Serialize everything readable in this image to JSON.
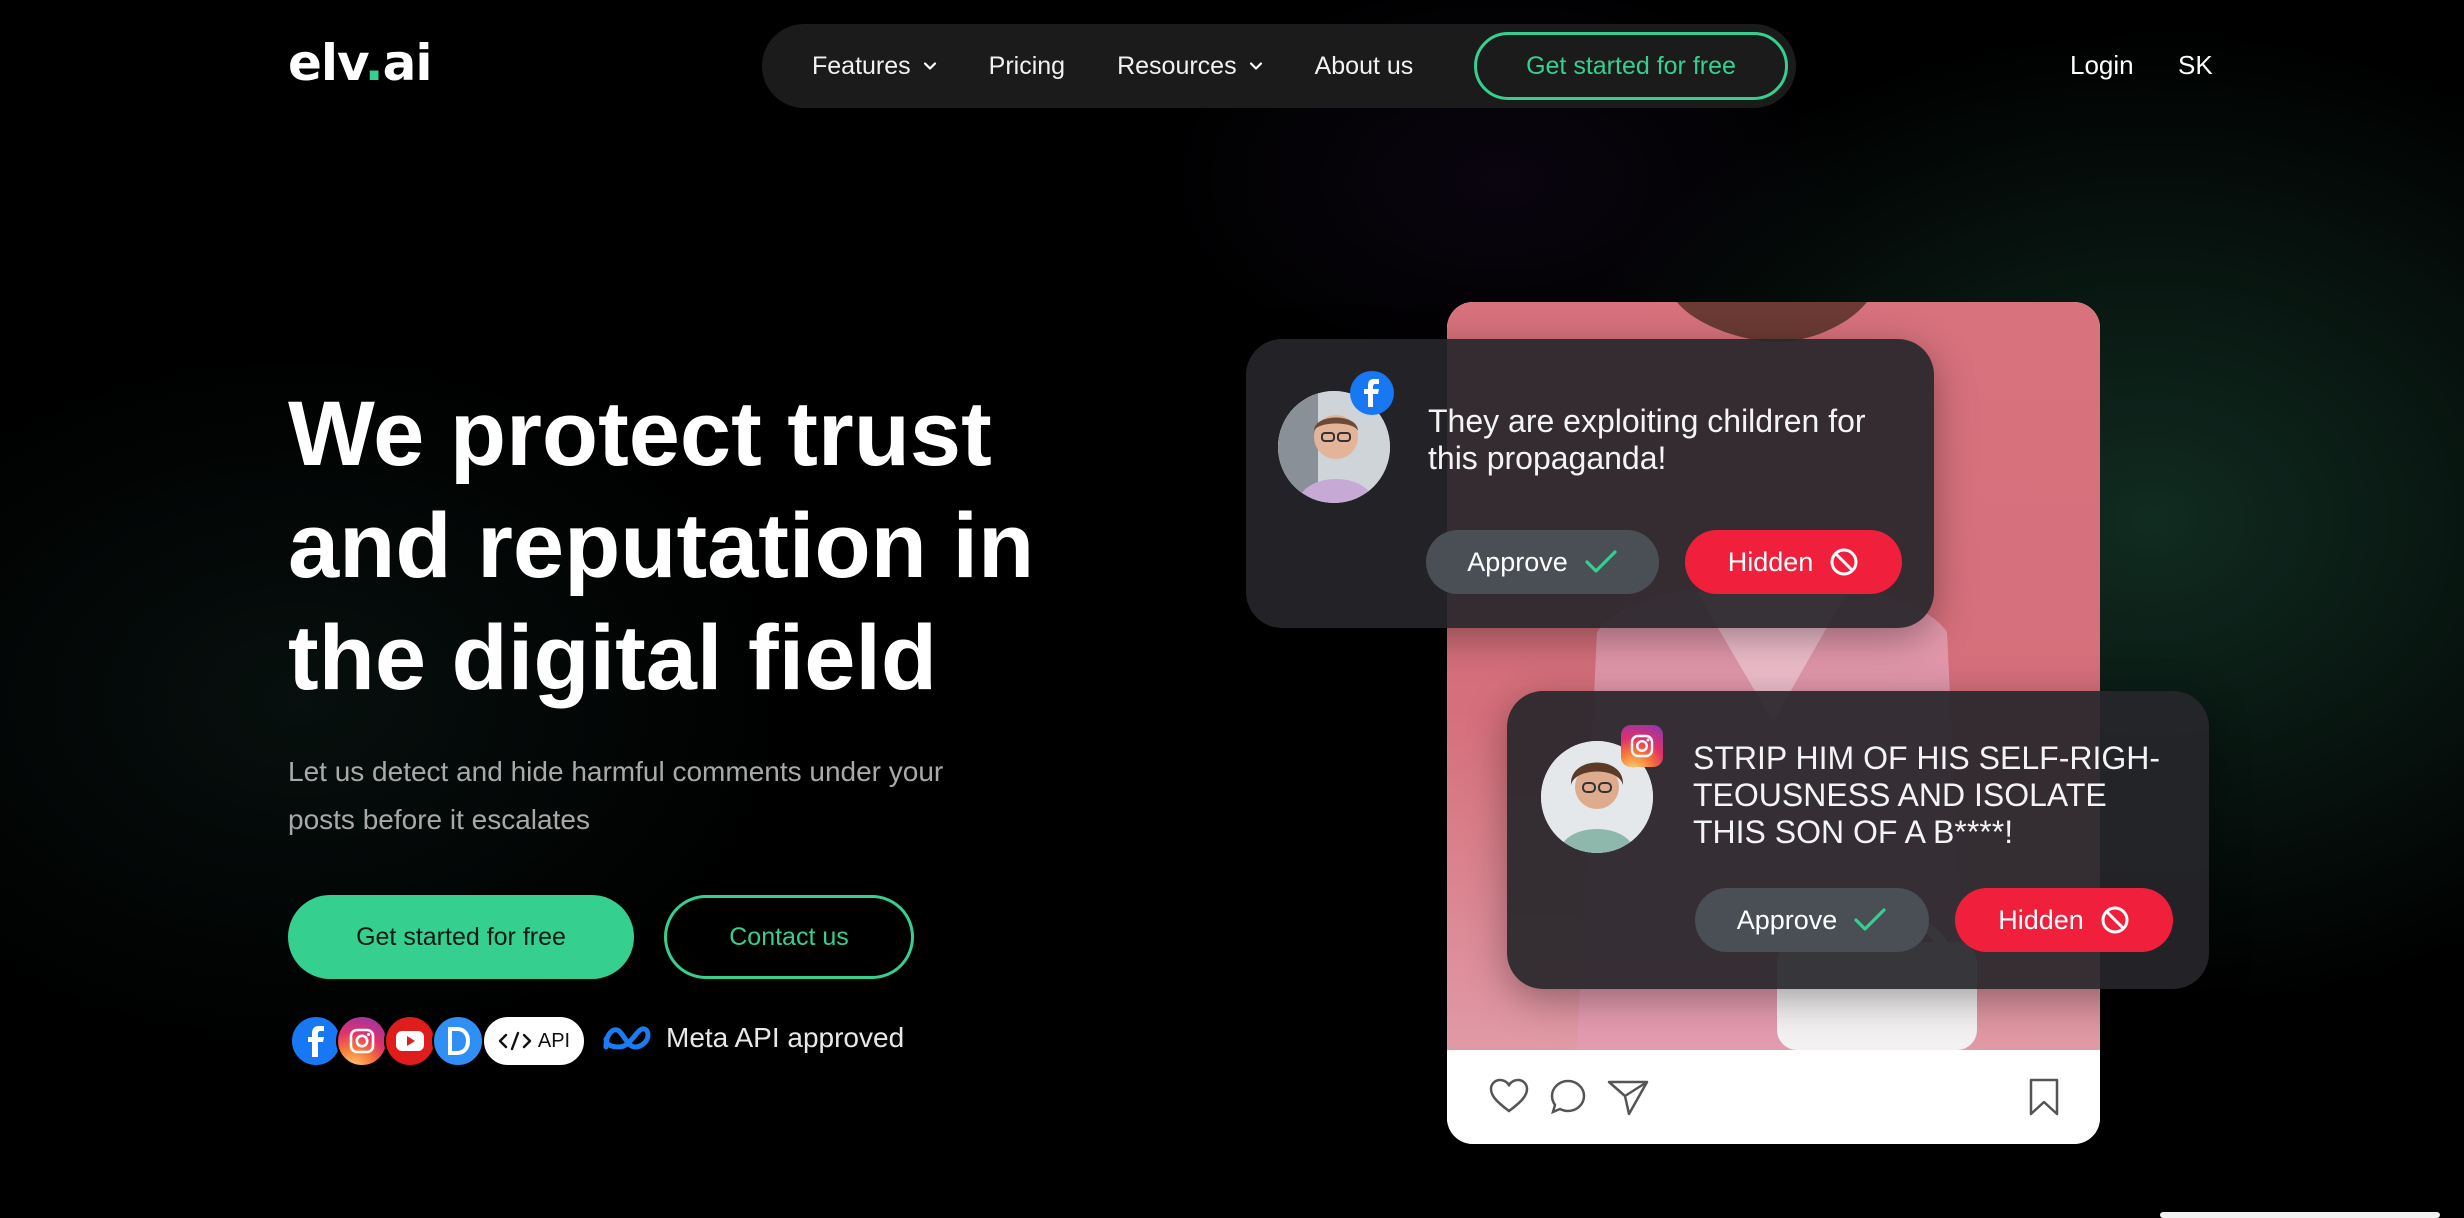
{
  "header": {
    "logo_prefix": "elv",
    "logo_dot": ".",
    "logo_suffix": "ai",
    "nav": [
      {
        "label": "Features",
        "has_dropdown": true
      },
      {
        "label": "Pricing",
        "has_dropdown": false
      },
      {
        "label": "Resources",
        "has_dropdown": true
      },
      {
        "label": "About us",
        "has_dropdown": false
      }
    ],
    "cta": "Get started for free",
    "login": "Login",
    "language": "SK"
  },
  "hero": {
    "title_lines": [
      "We protect trust",
      "and reputation in",
      "the digital field"
    ],
    "subtitle": "Let us detect and hide harmful comments under your posts before it escalates",
    "primary_button": "Get started for free",
    "secondary_button": "Contact us",
    "platform_icons": [
      "facebook-icon",
      "instagram-icon",
      "youtube-icon",
      "d-icon"
    ],
    "api_label": "API",
    "meta_label": "Meta API approved"
  },
  "comments": [
    {
      "platform": "facebook",
      "text": "They are exploiting children for this propaganda!",
      "approve_label": "Approve",
      "hidden_label": "Hidden"
    },
    {
      "platform": "instagram",
      "text": "STRIP HIM OF HIS SELF-RIGH-TEOUSNESS AND ISOLATE THIS SON OF A B****!",
      "approve_label": "Approve",
      "hidden_label": "Hidden"
    }
  ],
  "colors": {
    "accent": "#35d08f",
    "hidden_red": "#f0203c",
    "approve_gray": "#4a4f55",
    "post_pink": "#d8727d"
  }
}
